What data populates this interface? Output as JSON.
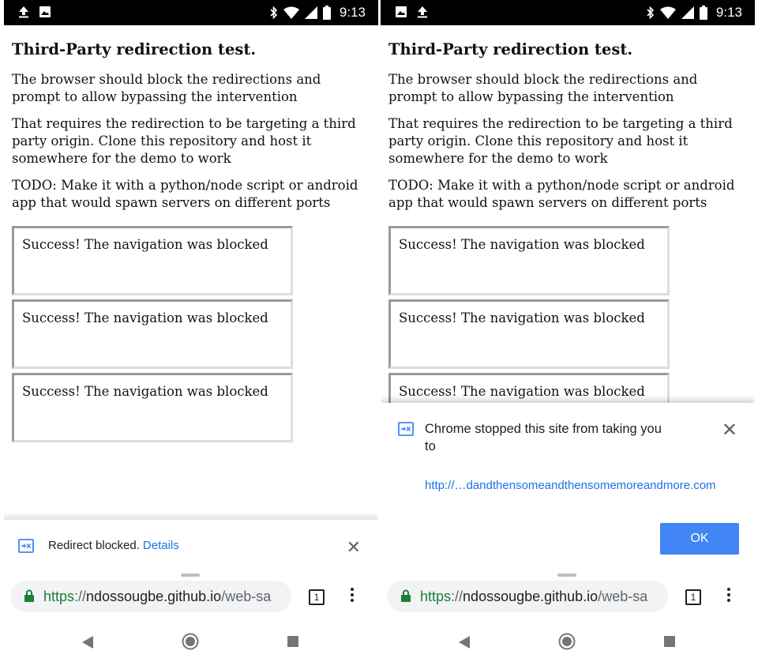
{
  "status_bar": {
    "time": "9:13"
  },
  "page": {
    "title": "Third-Party redirection test.",
    "paragraphs": [
      "The browser should block the redirections and prompt to allow bypassing the intervention",
      "That requires the redirection to be targeting a third party origin. Clone this repository and host it somewhere for the demo to work",
      "TODO: Make it with a python/node script or android app that would spawn servers on different ports"
    ],
    "frame_text": "Success! The navigation was blocked"
  },
  "infobar": {
    "message": "Redirect blocked.",
    "link": "Details",
    "icon": "redirect-blocked-icon"
  },
  "dialog": {
    "message": "Chrome stopped this site from taking you to",
    "url": "http://…dandthensomeandthensomemoreandmore.com",
    "ok_label": "OK",
    "icon": "redirect-blocked-icon"
  },
  "omnibox": {
    "scheme": "https",
    "separator": "://",
    "host": "ndossougbe.github.io",
    "path": "/web-sa"
  },
  "tab_count": "1",
  "colors": {
    "link_blue": "#1a73e8",
    "secure_green": "#188038",
    "ok_button": "#4285f4"
  }
}
